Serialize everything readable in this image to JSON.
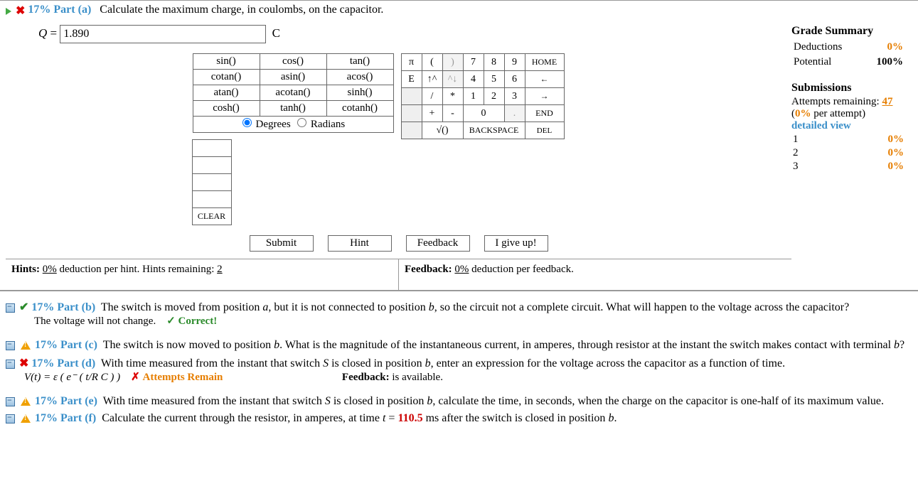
{
  "part_a": {
    "prefix_pct": "17%",
    "label": "Part (a)",
    "text": "Calculate the maximum charge, in coulombs, on the capacitor.",
    "var": "Q",
    "eq": "=",
    "value": "1.890",
    "unit": "C"
  },
  "functions": {
    "r1": [
      "sin()",
      "cos()",
      "tan()"
    ],
    "r2": [
      "cotan()",
      "asin()",
      "acos()"
    ],
    "r3": [
      "atan()",
      "acotan()",
      "sinh()"
    ],
    "r4": [
      "cosh()",
      "tanh()",
      "cotanh()"
    ],
    "mode_deg": "Degrees",
    "mode_rad": "Radians"
  },
  "keypad": {
    "pi": "π",
    "lp": "(",
    "rp": ")",
    "n7": "7",
    "n8": "8",
    "n9": "9",
    "home": "HOME",
    "E": "E",
    "up": "↑^",
    "dn": "^↓",
    "n4": "4",
    "n5": "5",
    "n6": "6",
    "left": "←",
    "bl": "",
    "sl": "/",
    "st": "*",
    "n1": "1",
    "n2": "2",
    "n3": "3",
    "right": "→",
    "pl": "+",
    "mi": "-",
    "n0": "0",
    "dot": ".",
    "end": "END",
    "sqrt": "√()",
    "bksp": "BACKSPACE",
    "del": "DEL",
    "clr": "CLEAR"
  },
  "actions": {
    "submit": "Submit",
    "hint": "Hint",
    "feedback": "Feedback",
    "giveup": "I give up!"
  },
  "hints": {
    "label": "Hints:",
    "pct": "0%",
    "mid": " deduction per hint. Hints remaining:",
    "rem": "2"
  },
  "feedback_row": {
    "label": "Feedback:",
    "pct": "0%",
    "tail": " deduction per feedback."
  },
  "grade": {
    "title": "Grade Summary",
    "ded_l": "Deductions",
    "ded_v": "0%",
    "pot_l": "Potential",
    "pot_v": "100%",
    "sub_title": "Submissions",
    "att_l": "Attempts remaining:",
    "att_v": "47",
    "per": "(0% per attempt)",
    "detailed": "detailed view",
    "rows": [
      [
        "1",
        "0%"
      ],
      [
        "2",
        "0%"
      ],
      [
        "3",
        "0%"
      ]
    ]
  },
  "parts": {
    "b": {
      "pct": "17%",
      "lbl": "Part (b)",
      "txt1": "The switch is moved from position ",
      "a": "a",
      "txt2": ", but it is not connected to position ",
      "b": "b",
      "txt3": ", so the circuit not a complete circuit. What will happen to the voltage across the capacitor?",
      "ans": "The voltage will not change.",
      "ok": "✓ Correct!"
    },
    "c": {
      "pct": "17%",
      "lbl": "Part (c)",
      "txt1": "The switch is now moved to position ",
      "b": "b",
      "txt2": ". What is the magnitude of the instantaneous current, in amperes, through resistor at the instant the switch makes contact with terminal ",
      "b2": "b",
      "txt3": "?"
    },
    "d": {
      "pct": "17%",
      "lbl": "Part (d)",
      "txt1": "With time measured from the instant that switch ",
      "S": "S",
      "txt2": " is closed in position ",
      "b": "b",
      "txt3": ", enter an expression for the voltage across the capacitor as a function of time.",
      "ans": "V(t) = ε ( e⁻ ( t/R C ) )",
      "fail": "✗ Attempts Remain",
      "fb_l": "Feedback:",
      "fb_t": " is available."
    },
    "e": {
      "pct": "17%",
      "lbl": "Part (e)",
      "txt1": "With time measured from the instant that switch ",
      "S": "S",
      "txt2": " is closed in position ",
      "b": "b",
      "txt3": ", calculate the time, in seconds, when the charge on the capacitor is one-half of its maximum value."
    },
    "f": {
      "pct": "17%",
      "lbl": "Part (f)",
      "txt1": "Calculate the current through the resistor, in amperes, at time ",
      "tvar": "t",
      "eq": " = ",
      "tval": "110.5",
      "unit": " ms",
      "txt2": " after the switch is closed in position ",
      "b": "b",
      "txt3": "."
    }
  }
}
